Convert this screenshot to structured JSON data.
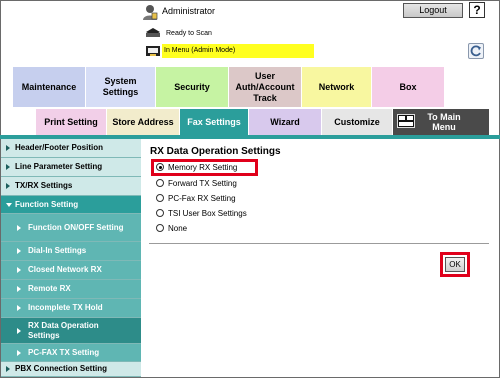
{
  "header": {
    "user": "Administrator",
    "logout_label": "Logout",
    "help_label": "?",
    "status": "Ready to Scan",
    "mode": "In Menu (Admin Mode)"
  },
  "main_tabs": [
    {
      "label": "Maintenance",
      "color": "#c6cfee"
    },
    {
      "label": "System Settings",
      "color": "#d6ddf6"
    },
    {
      "label": "Security",
      "color": "#c6f3a3"
    },
    {
      "label": "User Auth/Account Track",
      "color": "#dcc8c8"
    },
    {
      "label": "Network",
      "color": "#f8f7a0"
    },
    {
      "label": "Box",
      "color": "#f4cde7"
    }
  ],
  "sub_tabs": [
    {
      "label": "Print Setting",
      "color": "#f2cfe8"
    },
    {
      "label": "Store Address",
      "color": "#f2eccc"
    },
    {
      "label": "Fax Settings",
      "color": "#2b9e9b"
    },
    {
      "label": "Wizard",
      "color": "#d8c9ed"
    },
    {
      "label": "Customize",
      "color": "#e6e6e6"
    },
    {
      "label": "To Main Menu",
      "color": "#4a4a4a"
    }
  ],
  "sidebar": {
    "items": [
      {
        "label": "Header/Footer Position"
      },
      {
        "label": "Line Parameter Setting"
      },
      {
        "label": "TX/RX Settings"
      },
      {
        "label": "Function Setting"
      },
      {
        "label": "Function ON/OFF Setting"
      },
      {
        "label": "Dial-In Settings"
      },
      {
        "label": "Closed Network RX"
      },
      {
        "label": "Remote RX"
      },
      {
        "label": "Incomplete TX Hold"
      },
      {
        "label": "RX Data Operation Settings"
      },
      {
        "label": "PC-FAX TX Setting"
      },
      {
        "label": "PBX Connection Setting"
      }
    ]
  },
  "content": {
    "title": "RX Data Operation Settings",
    "options": [
      {
        "label": "Memory RX Setting",
        "checked": true
      },
      {
        "label": "Forward TX Setting",
        "checked": false
      },
      {
        "label": "PC-Fax RX Setting",
        "checked": false
      },
      {
        "label": "TSI User Box Settings",
        "checked": false
      },
      {
        "label": "None",
        "checked": false
      }
    ],
    "ok_label": "OK"
  },
  "colors": {
    "accent": "#2b9e9b",
    "highlight": "#e0001b",
    "mode_bar": "#ffff20"
  }
}
